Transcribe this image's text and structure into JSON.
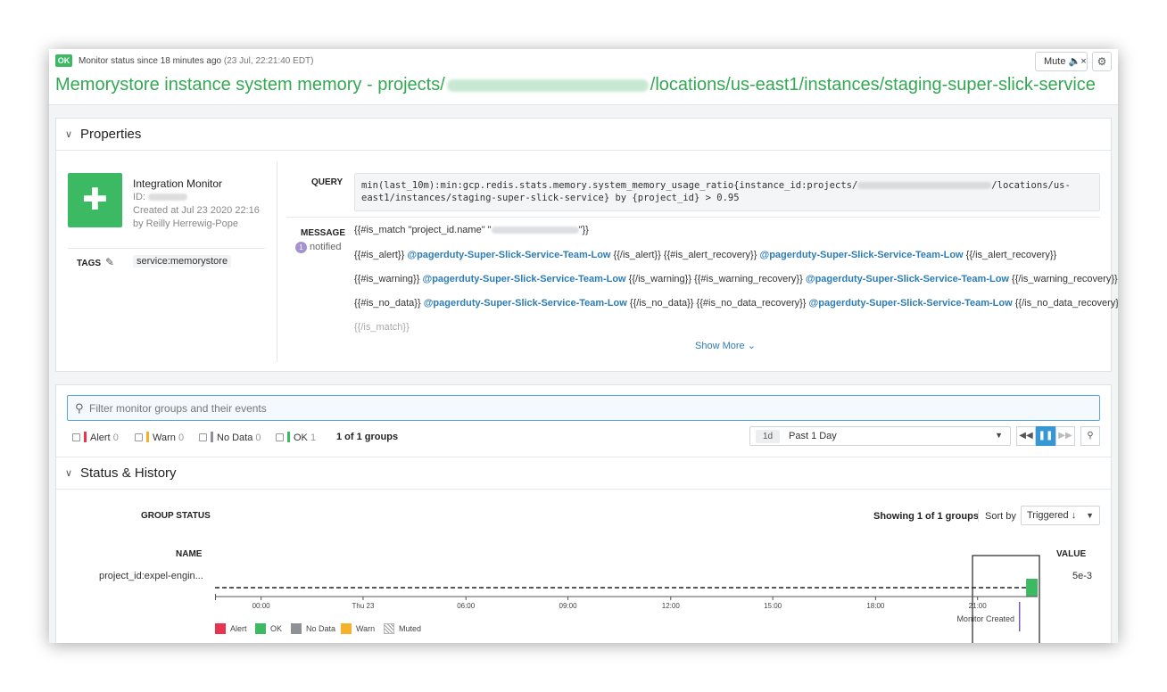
{
  "header": {
    "status_badge": "OK",
    "status_text": "Monitor status since 18 minutes ago",
    "status_time": "(23 Jul, 22:21:40 EDT)",
    "title_prefix": "Memorystore instance system memory - projects/",
    "title_suffix": "/locations/us-east1/instances/staging-super-slick-service",
    "mute_label": "Mute",
    "gear_icon": "gear-icon",
    "speaker_icon": "speaker-mute-icon"
  },
  "properties": {
    "section_title": "Properties",
    "integration_name": "Integration Monitor",
    "id_label": "ID:",
    "created": "Created at Jul 23 2020 22:16",
    "created_by": "by Reilly Herrewig-Pope",
    "tags_label": "TAGS",
    "tag": "service:memorystore",
    "query_label": "QUERY",
    "query_part1": "min(last_10m):min:gcp.redis.stats.memory.system_memory_usage_ratio{instance_id:projects/",
    "query_part2": "/locations/us-",
    "query_part3": "east1/instances/staging-super-slick-service} by {project_id} > 0.95",
    "message_label": "MESSAGE",
    "notified_count": "1",
    "notified_label": "notified",
    "msg_line1_a": "{{#is_match \"project_id.name\" \"",
    "msg_line1_b": "\"}}",
    "msg_alert_open": "{{#is_alert}}",
    "msg_alert_close": "{{/is_alert}}",
    "msg_alert_rec_open": "{{#is_alert_recovery}}",
    "msg_alert_rec_close": "{{/is_alert_recovery}}",
    "msg_warn_open": "{{#is_warning}}",
    "msg_warn_close": "{{/is_warning}}",
    "msg_warn_rec_open": "{{#is_warning_recovery}}",
    "msg_warn_rec_close": "{{/is_warning_recovery}}",
    "msg_nodata_open": "{{#is_no_data}}",
    "msg_nodata_close": "{{/is_no_data}}",
    "msg_nodata_rec_open": "{{#is_no_data_recovery}}",
    "msg_nodata_rec_close": "{{/is_no_data_recovery}}",
    "pagerduty_handle": "@pagerduty-Super-Slick-Service-Team-Low",
    "msg_last": "{{/is_match}}",
    "show_more": "Show More"
  },
  "groups": {
    "filter_placeholder": "Filter monitor groups and their events",
    "filters": [
      {
        "label": "Alert",
        "count": "0",
        "color": "#e8344e"
      },
      {
        "label": "Warn",
        "count": "0",
        "color": "#f6b02c"
      },
      {
        "label": "No Data",
        "count": "0",
        "color": "#8e9297"
      },
      {
        "label": "OK",
        "count": "1",
        "color": "#3cb963"
      }
    ],
    "groups_count": "1 of 1 groups",
    "time_chip": "1d",
    "time_label": "Past 1 Day"
  },
  "status_history": {
    "section_title": "Status & History",
    "group_status_label": "GROUP STATUS",
    "showing": "Showing 1 of 1 groups",
    "sort_by": "Sort by",
    "sort_value": "Triggered ↓",
    "name_head": "NAME",
    "value_head": "VALUE",
    "row_name": "project_id:expel-engin...",
    "row_value": "5e-3",
    "ticks": [
      "00:00",
      "Thu 23",
      "06:00",
      "09:00",
      "12:00",
      "15:00",
      "18:00",
      "21:00"
    ],
    "tick_fracs": [
      0.056,
      0.18,
      0.305,
      0.429,
      0.554,
      0.678,
      0.803,
      0.927
    ],
    "ok_start_frac": 0.986,
    "marker_frac": 0.978,
    "marker_label": "Monitor Created",
    "legend": [
      {
        "label": "Alert",
        "color": "#e8344e"
      },
      {
        "label": "OK",
        "color": "#3cb963"
      },
      {
        "label": "No Data",
        "color": "#8e9297"
      },
      {
        "label": "Warn",
        "color": "#f6b02c"
      },
      {
        "label": "Muted",
        "color": "muted"
      }
    ]
  }
}
